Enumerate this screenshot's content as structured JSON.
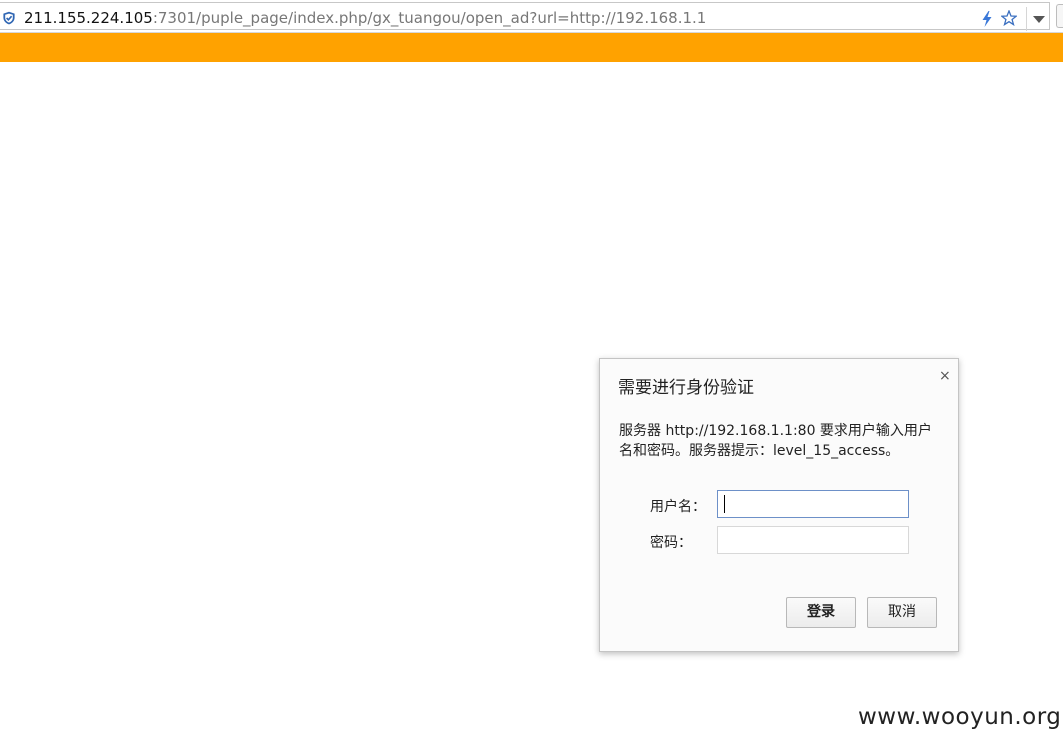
{
  "browser": {
    "url_host": "211.155.224.105",
    "url_rest": ":7301/puple_page/index.php/gx_tuangou/open_ad?url=http://192.168.1.1",
    "icons": [
      "shield-icon",
      "bolt-icon",
      "star-icon",
      "chevron-down-icon"
    ]
  },
  "page": {
    "banner_color": "#ffa200"
  },
  "auth_dialog": {
    "title": "需要进行身份验证",
    "message": "服务器 http://192.168.1.1:80 要求用户输入用户名和密码。服务器提示：level_15_access。",
    "username_label": "用户名：",
    "password_label": "密码：",
    "username_value": "",
    "password_value": "",
    "login_label": "登录",
    "cancel_label": "取消",
    "close_glyph": "×"
  },
  "watermark": "www.wooyun.org"
}
